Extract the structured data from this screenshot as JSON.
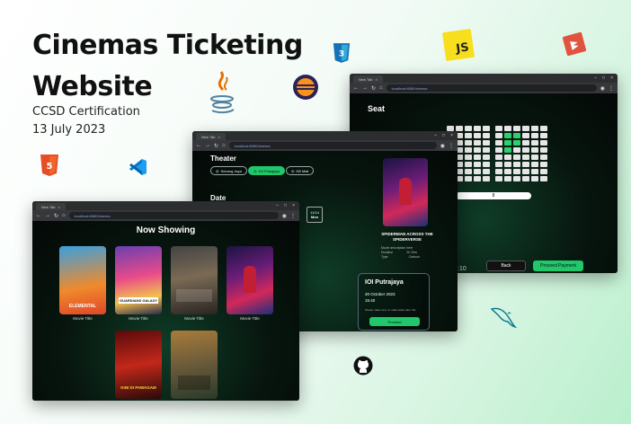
{
  "hero": {
    "title_line1": "Cinemas Ticketing",
    "title_line2": "Website",
    "certification": "CCSD Certification",
    "date": "13 July 2023"
  },
  "decor_icons": [
    "html5-icon",
    "css3-icon",
    "java-icon",
    "eclipse-icon",
    "javascript-icon",
    "scala-icon",
    "vscode-icon",
    "mysql-icon",
    "github-icon"
  ],
  "js_badge": "JS",
  "browser": {
    "tab_label": "New Tab",
    "url": "localhost:8080/cinema"
  },
  "now_showing": {
    "heading": "Now Showing",
    "movies": [
      {
        "title": "Movie Title",
        "poster_text": "ELEMENTAL"
      },
      {
        "title": "Movie Title",
        "poster_text": "GUARDIANS GALAXY"
      },
      {
        "title": "Movie Title",
        "poster_text": ""
      },
      {
        "title": "Movie Title",
        "poster_text": ""
      },
      {
        "title": "",
        "poster_text": "KINI DI PAWAGAM"
      },
      {
        "title": "",
        "poster_text": ""
      }
    ]
  },
  "booking": {
    "theater_heading": "Theater",
    "theaters": [
      "Subang Jaya",
      "IOI Putrajaya",
      "KB Mall"
    ],
    "date_heading": "Date",
    "date_chip": {
      "day": "11/14",
      "label": "Mon"
    },
    "movie_name": "SPIDERMAN ACROSS THE SPIDERVERSE",
    "movie_info": [
      "Movie description here",
      "Duration",
      "Type"
    ],
    "movie_info_values": [
      "",
      "2h 20m",
      "Cartoon"
    ],
    "cinema": "IOI Putrajaya",
    "show_date": "20 October 2023",
    "show_time": "15:40",
    "note": "Please make sure, to make ticket after this",
    "proceed": "Proceed"
  },
  "seat_page": {
    "heading": "Seat",
    "screen_label": "8",
    "time_fragment": ":10",
    "back": "Back",
    "proceed_payment": "Proceed Payment"
  },
  "colors": {
    "accent": "#21c76b",
    "dark": "#07150e"
  }
}
